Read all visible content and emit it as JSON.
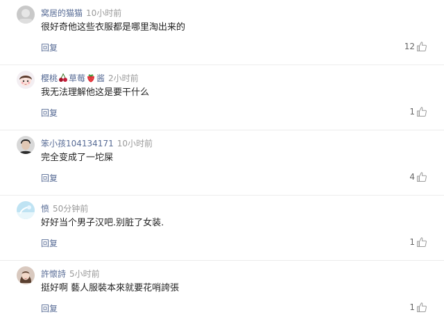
{
  "comments": [
    {
      "username": "窝居的猫猫",
      "time": "10小时前",
      "text": "很好奇他这些衣服都是哪里淘出来的",
      "reply_label": "回复",
      "likes": "12",
      "avatar": "grey-placeholder"
    },
    {
      "username_parts": [
        "樱桃",
        "草莓",
        "酱"
      ],
      "time": "2小时前",
      "text": "我无法理解他这是要干什么",
      "reply_label": "回复",
      "likes": "1",
      "avatar": "cartoon-girl"
    },
    {
      "username": "笨小孩104134171",
      "time": "10小时前",
      "text": "完全变成了一坨屎",
      "reply_label": "回复",
      "likes": "4",
      "avatar": "man-portrait"
    },
    {
      "username": "愤",
      "time": "50分钟前",
      "text": "好好当个男子汉吧.别脏了女装.",
      "reply_label": "回复",
      "likes": "1",
      "avatar": "blue-sky"
    },
    {
      "username": "許懷詩",
      "time": "5小时前",
      "text": "挺好啊 藝人服裝本來就要花哨誇張",
      "reply_label": "回复",
      "likes": "1",
      "avatar": "woman-portrait"
    }
  ],
  "colors": {
    "username": "#576b95",
    "time": "#999999",
    "reply": "#576b95",
    "icon": "#9b9b9b"
  }
}
